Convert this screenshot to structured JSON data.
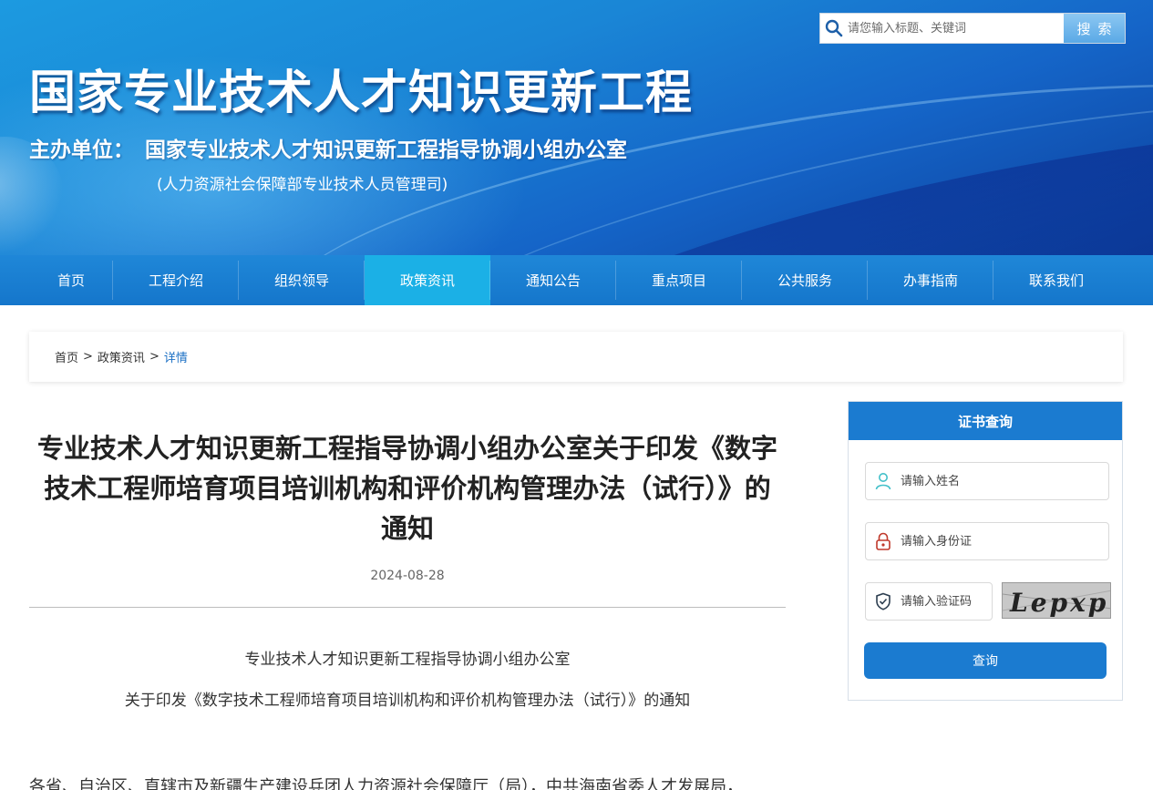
{
  "header": {
    "site_title": "国家专业技术人才知识更新工程",
    "host_label": "主办单位：",
    "host_name": "国家专业技术人才知识更新工程指导协调小组办公室",
    "host_sub": "(人力资源社会保障部专业技术人员管理司)"
  },
  "search": {
    "placeholder": "请您输入标题、关键词",
    "button_label": "搜索",
    "icon": "search-icon"
  },
  "nav": {
    "items": [
      {
        "label": "首页"
      },
      {
        "label": "工程介绍"
      },
      {
        "label": "组织领导"
      },
      {
        "label": "政策资讯",
        "active": true
      },
      {
        "label": "通知公告"
      },
      {
        "label": "重点项目"
      },
      {
        "label": "公共服务"
      },
      {
        "label": "办事指南"
      },
      {
        "label": "联系我们"
      }
    ]
  },
  "breadcrumb": {
    "home": "首页",
    "section": "政策资讯",
    "current": "详情",
    "separator": ">"
  },
  "article": {
    "title": "专业技术人才知识更新工程指导协调小组办公室关于印发《数字技术工程师培育项目培训机构和评价机构管理办法（试行）》的通知",
    "date": "2024-08-28",
    "heading_line1": "专业技术人才知识更新工程指导协调小组办公室",
    "heading_line2": "关于印发《数字技术工程师培育项目培训机构和评价机构管理办法（试行）》的通知",
    "body_first_line": "各省、自治区、直辖市及新疆生产建设兵团人力资源社会保障厅（局），中共海南省委人才发展局，"
  },
  "cert_query": {
    "title": "证书查询",
    "name_placeholder": "请输入姓名",
    "id_placeholder": "请输入身份证",
    "code_placeholder": "请输入验证码",
    "captcha_text": "Lepxp",
    "button_label": "查询",
    "colors": {
      "accent": "#1b7bd0",
      "name_icon": "#43c0c9",
      "id_icon": "#c0392b"
    }
  }
}
